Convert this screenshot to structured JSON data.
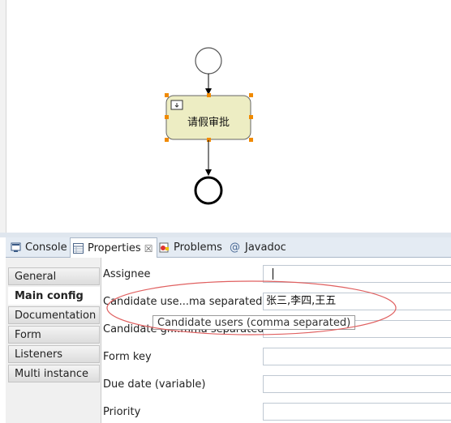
{
  "diagram": {
    "task_label": "请假审批"
  },
  "tabs": [
    {
      "label": "Console",
      "icon": "console-icon"
    },
    {
      "label": "Properties",
      "icon": "properties-icon",
      "active": true,
      "close": "☒"
    },
    {
      "label": "Problems",
      "icon": "problems-icon"
    },
    {
      "label": "Javadoc",
      "icon": "at-icon",
      "glyph": "@"
    }
  ],
  "categories": [
    "General",
    "Main config",
    "Documentation",
    "Form",
    "Listeners",
    "Multi instance"
  ],
  "selected_category": "Main config",
  "fields": [
    {
      "label": "Assignee",
      "value": ""
    },
    {
      "label": "Candidate use...ma separated)",
      "value": "张三,李四,王五"
    },
    {
      "label": "Candidate gr...mma separated)",
      "value": ""
    },
    {
      "label": "Form key",
      "value": ""
    },
    {
      "label": "Due date (variable)",
      "value": ""
    },
    {
      "label": "Priority",
      "value": ""
    }
  ],
  "tooltip": "Candidate users (comma separated)",
  "colors": {
    "task_fill": "#ededc3",
    "handle": "#f08a00",
    "annotation_ellipse": "#e06060"
  }
}
